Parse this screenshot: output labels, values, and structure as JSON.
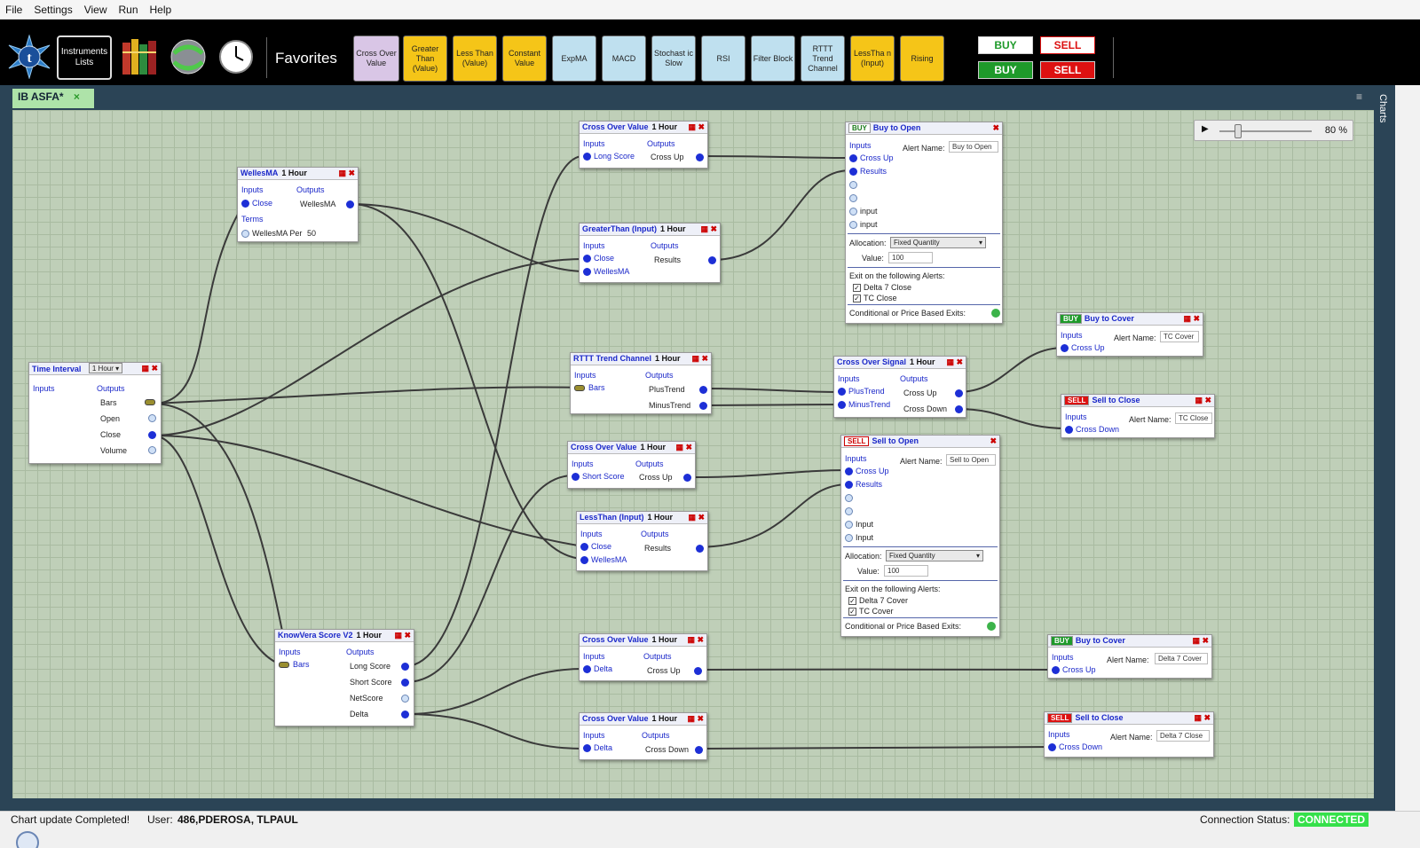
{
  "menu": [
    "File",
    "Settings",
    "View",
    "Run",
    "Help"
  ],
  "toolbar": {
    "logo": "t",
    "instruments_label": "Instruments Lists",
    "favorites_label": "Favorites",
    "favorites": [
      {
        "label": "Cross Over Value",
        "color": "#d9c6e6"
      },
      {
        "label": "Greater Than (Value)",
        "color": "#f5c518"
      },
      {
        "label": "Less Than (Value)",
        "color": "#f5c518"
      },
      {
        "label": "Constant Value",
        "color": "#f5c518"
      },
      {
        "label": "ExpMA",
        "color": "#bfe0ef"
      },
      {
        "label": "MACD",
        "color": "#bfe0ef"
      },
      {
        "label": "Stochast ic Slow",
        "color": "#bfe0ef"
      },
      {
        "label": "RSI",
        "color": "#bfe0ef"
      },
      {
        "label": "Filter Block",
        "color": "#bfe0ef"
      },
      {
        "label": "RTTT Trend Channel",
        "color": "#bfe0ef"
      },
      {
        "label": "LessTha n (Input)",
        "color": "#f5c518"
      },
      {
        "label": "Rising",
        "color": "#f5c518"
      }
    ],
    "buy_top": "BUY",
    "sell_top": "SELL",
    "buy_bottom": "BUY",
    "sell_bottom": "SELL"
  },
  "tab": {
    "label": "IB ASFA*",
    "close": "×"
  },
  "side_panel": "Charts",
  "zoom": {
    "play": "▶",
    "value": "80 %",
    "level": 0.2
  },
  "nodes": {
    "time_interval": {
      "title": "Time Interval",
      "interval": "1 Hour",
      "inputs": "Inputs",
      "outputs": "Outputs",
      "o1": "Bars",
      "o2": "Open",
      "o3": "Close",
      "o4": "Volume"
    },
    "welles": {
      "title": "WellesMA",
      "interval": "1 Hour",
      "inputs": "Inputs",
      "outputs": "Outputs",
      "i1": "Close",
      "o1": "WellesMA",
      "terms": "Terms",
      "t1": "WellesMA Per",
      "t1v": "50"
    },
    "kv": {
      "title": "KnowVera Score V2",
      "interval": "1 Hour",
      "inputs": "Inputs",
      "outputs": "Outputs",
      "i1": "Bars",
      "o1": "Long Score",
      "o2": "Short Score",
      "o3": "NetScore",
      "o4": "Delta"
    },
    "cov1": {
      "title": "Cross Over Value",
      "interval": "1 Hour",
      "inputs": "Inputs",
      "outputs": "Outputs",
      "i1": "Long Score",
      "o1": "Cross Up"
    },
    "gt": {
      "title": "GreaterThan (Input)",
      "interval": "1 Hour",
      "inputs": "Inputs",
      "outputs": "Outputs",
      "i1": "Close",
      "i2": "WellesMA",
      "o1": "Results"
    },
    "rttt": {
      "title": "RTTT Trend Channel",
      "interval": "1 Hour",
      "inputs": "Inputs",
      "outputs": "Outputs",
      "i1": "Bars",
      "o1": "PlusTrend",
      "o2": "MinusTrend"
    },
    "cov2": {
      "title": "Cross Over Value",
      "interval": "1 Hour",
      "inputs": "Inputs",
      "outputs": "Outputs",
      "i1": "Short Score",
      "o1": "Cross Up"
    },
    "lt": {
      "title": "LessThan (Input)",
      "interval": "1 Hour",
      "inputs": "Inputs",
      "outputs": "Outputs",
      "i1": "Close",
      "i2": "WellesMA",
      "o1": "Results"
    },
    "cov3": {
      "title": "Cross Over Value",
      "interval": "1 Hour",
      "inputs": "Inputs",
      "outputs": "Outputs",
      "i1": "Delta",
      "o1": "Cross Up"
    },
    "cov4": {
      "title": "Cross Over Value",
      "interval": "1 Hour",
      "inputs": "Inputs",
      "outputs": "Outputs",
      "i1": "Delta",
      "o1": "Cross Down"
    },
    "cos": {
      "title": "Cross Over Signal",
      "interval": "1 Hour",
      "inputs": "Inputs",
      "outputs": "Outputs",
      "i1": "PlusTrend",
      "i2": "MinusTrend",
      "o1": "Cross Up",
      "o2": "Cross Down"
    },
    "bto": {
      "badge": "BUY",
      "title": "Buy to Open",
      "inputs": "Inputs",
      "alert_label": "Alert Name:",
      "alert": "Buy to Open",
      "i1": "Cross Up",
      "i2": "Results",
      "i5": "input",
      "i6": "input",
      "alloc_label": "Allocation:",
      "alloc": "Fixed Quantity",
      "value_label": "Value:",
      "value": "100",
      "exit_label": "Exit on the following Alerts:",
      "e1": "Delta 7 Close",
      "e2": "TC Close",
      "cond": "Conditional or Price Based Exits:"
    },
    "sto": {
      "badge": "SELL",
      "title": "Sell to Open",
      "inputs": "Inputs",
      "alert_label": "Alert Name:",
      "alert": "Sell to Open",
      "i1": "Cross Up",
      "i2": "Results",
      "i5": "Input",
      "i6": "Input",
      "alloc_label": "Allocation:",
      "alloc": "Fixed Quantity",
      "value_label": "Value:",
      "value": "100",
      "exit_label": "Exit on the following Alerts:",
      "e1": "Delta 7 Cover",
      "e2": "TC Cover",
      "cond": "Conditional or Price Based Exits:"
    },
    "btc1": {
      "badge": "BUY",
      "title": "Buy to Cover",
      "inputs": "Inputs",
      "alert_label": "Alert Name:",
      "alert": "TC Cover",
      "i1": "Cross Up"
    },
    "stc1": {
      "badge": "SELL",
      "title": "Sell to Close",
      "inputs": "Inputs",
      "alert_label": "Alert Name:",
      "alert": "TC Close",
      "i1": "Cross Down"
    },
    "btc2": {
      "badge": "BUY",
      "title": "Buy to Cover",
      "inputs": "Inputs",
      "alert_label": "Alert Name:",
      "alert": "Delta 7 Cover",
      "i1": "Cross Up"
    },
    "stc2": {
      "badge": "SELL",
      "title": "Sell to Close",
      "inputs": "Inputs",
      "alert_label": "Alert Name:",
      "alert": "Delta 7 Close",
      "i1": "Cross Down"
    }
  },
  "status": {
    "message": "Chart update Completed!",
    "user_label": "User:",
    "user": "486,PDEROSA, TLPAUL",
    "conn_label": "Connection Status:",
    "conn": "CONNECTED"
  },
  "colors": {
    "accent_green": "#35e04a",
    "port_blue": "#1d2fd6",
    "buy_green": "#1e9a2a",
    "sell_red": "#d11"
  }
}
